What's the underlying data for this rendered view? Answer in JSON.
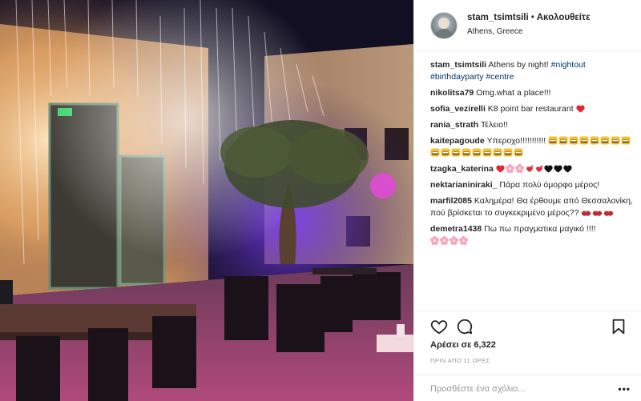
{
  "post": {
    "username": "stam_tsimtsili",
    "separator": "•",
    "follow_label": "Ακολουθείτε",
    "location": "Athens, Greece",
    "caption_user": "stam_tsimtsili",
    "caption_text": "Athens by night!",
    "caption_tags": [
      "#nightout",
      "#birthdayparty",
      "#centre"
    ]
  },
  "comments": [
    {
      "user": "nikolitsa79",
      "text": "Omg.what a place!!!",
      "emojis": []
    },
    {
      "user": "sofia_vezirelli",
      "text": "K8 point bar restaurant",
      "emojis": [
        "red-heart"
      ]
    },
    {
      "user": "rania_strath",
      "text": "Τέλειο!!",
      "emojis": []
    },
    {
      "user": "kaitepagoude",
      "text": "Υπεροχο!!!!!!!!!!!",
      "emojis": [
        "grinning-face",
        "grinning-face",
        "grinning-face",
        "grinning-face",
        "grinning-face",
        "grinning-face",
        "grinning-face",
        "grinning-face",
        "grinning-face",
        "grinning-face",
        "grinning-face",
        "grinning-face",
        "grinning-face",
        "grinning-face",
        "grinning-face",
        "grinning-face",
        "grinning-face"
      ]
    },
    {
      "user": "tzagka_katerina",
      "text": "",
      "emojis": [
        "red-heart",
        "cherry-blossom",
        "cherry-blossom",
        "revolving-hearts",
        "revolving-hearts",
        "black-heart",
        "black-heart",
        "black-heart"
      ]
    },
    {
      "user": "nektarianiniraki_",
      "text": "Πάρα πολύ όμορφο μέρος!",
      "emojis": []
    },
    {
      "user": "marfil2085",
      "text": "Καλημέρα! Θα έρθουμε από Θεσσαλονίκη, πού βρίσκεται το συγκεκριμένο μέρος??",
      "emojis": [
        "kiss-mark",
        "kiss-mark",
        "kiss-mark"
      ]
    },
    {
      "user": "demetra1438",
      "text": "Πω πω πραγματικα μαγικό !!!!",
      "emojis": [
        "cherry-blossom",
        "cherry-blossom",
        "cherry-blossom",
        "cherry-blossom"
      ]
    }
  ],
  "actions": {
    "like_icon": "heart-outline-icon",
    "comment_icon": "speech-bubble-icon",
    "save_icon": "bookmark-icon",
    "likes_label": "Αρέσει σε 6,322",
    "time_label": "ΠΡΙΝ ΑΠΟ 11 ΩΡΕΣ"
  },
  "comment_box": {
    "placeholder": "Προσθέστε ένα σχόλιο...",
    "more_label": "•••"
  },
  "colors": {
    "hashtag": "#003569",
    "border": "#efefef",
    "muted": "#999999"
  }
}
